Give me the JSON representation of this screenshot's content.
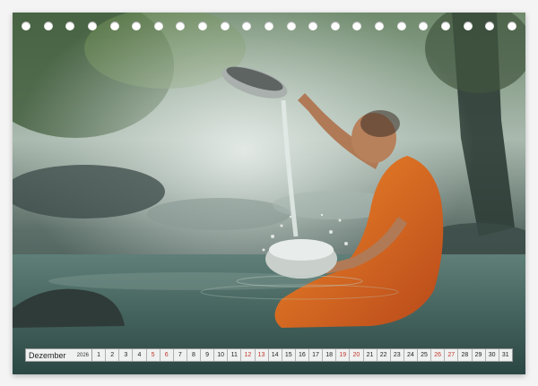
{
  "calendar": {
    "month": "Dezember",
    "year": "2026",
    "weekend_color": "#c0392b",
    "days": [
      {
        "n": "1",
        "weekend": false
      },
      {
        "n": "2",
        "weekend": false
      },
      {
        "n": "3",
        "weekend": false
      },
      {
        "n": "4",
        "weekend": false
      },
      {
        "n": "5",
        "weekend": true
      },
      {
        "n": "6",
        "weekend": true
      },
      {
        "n": "7",
        "weekend": false
      },
      {
        "n": "8",
        "weekend": false
      },
      {
        "n": "9",
        "weekend": false
      },
      {
        "n": "10",
        "weekend": false
      },
      {
        "n": "11",
        "weekend": false
      },
      {
        "n": "12",
        "weekend": true
      },
      {
        "n": "13",
        "weekend": true
      },
      {
        "n": "14",
        "weekend": false
      },
      {
        "n": "15",
        "weekend": false
      },
      {
        "n": "16",
        "weekend": false
      },
      {
        "n": "17",
        "weekend": false
      },
      {
        "n": "18",
        "weekend": false
      },
      {
        "n": "19",
        "weekend": true
      },
      {
        "n": "20",
        "weekend": true
      },
      {
        "n": "21",
        "weekend": false
      },
      {
        "n": "22",
        "weekend": false
      },
      {
        "n": "23",
        "weekend": false
      },
      {
        "n": "24",
        "weekend": false
      },
      {
        "n": "25",
        "weekend": false
      },
      {
        "n": "26",
        "weekend": true
      },
      {
        "n": "27",
        "weekend": true
      },
      {
        "n": "28",
        "weekend": false
      },
      {
        "n": "29",
        "weekend": false
      },
      {
        "n": "30",
        "weekend": false
      },
      {
        "n": "31",
        "weekend": false
      }
    ]
  },
  "photo": {
    "subject": "young-monk-pouring-water",
    "robe_color": "#d9621c",
    "water_color": "#4a6f6a",
    "mist_color": "#c9d6cf"
  },
  "binding": {
    "hole_count": 23
  }
}
